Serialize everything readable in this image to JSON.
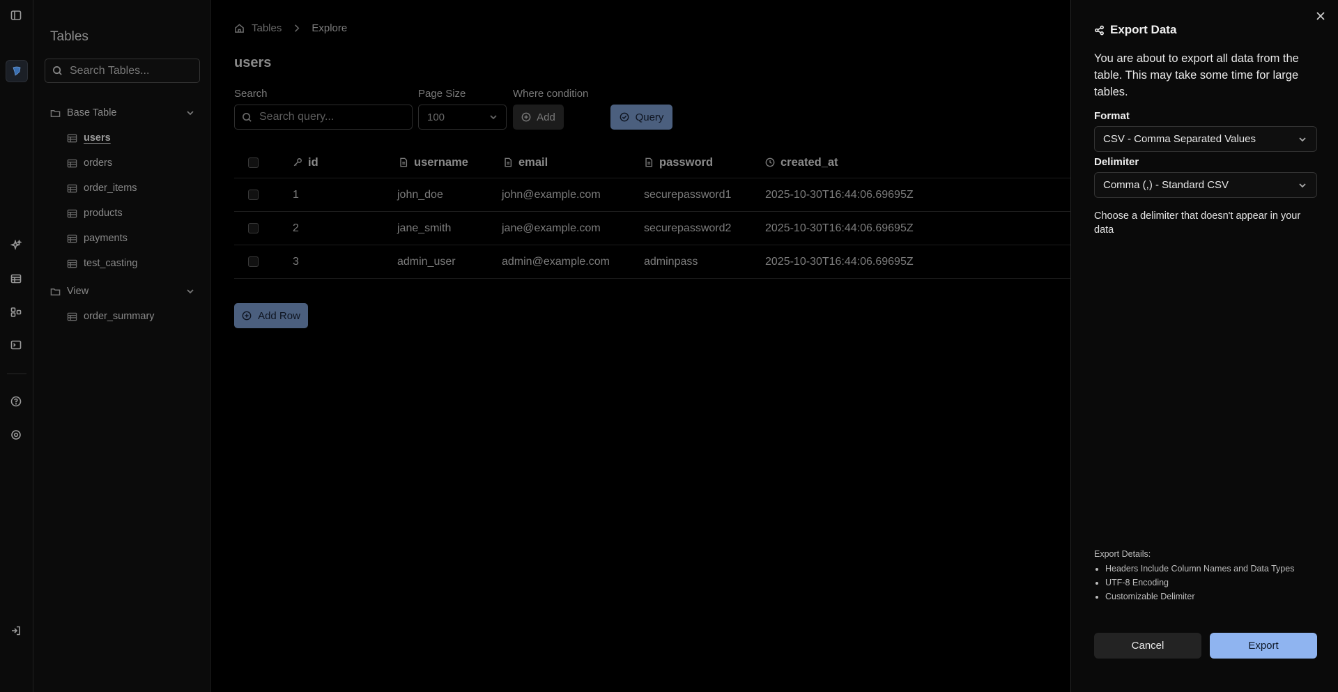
{
  "sidebar": {
    "title": "Tables",
    "search_placeholder": "Search Tables...",
    "groups": [
      {
        "label": "Base Table",
        "items": [
          "users",
          "orders",
          "order_items",
          "products",
          "payments",
          "test_casting"
        ]
      },
      {
        "label": "View",
        "items": [
          "order_summary"
        ]
      }
    ],
    "active_item": "users"
  },
  "breadcrumb": {
    "root": "Tables",
    "current": "Explore"
  },
  "page": {
    "title": "users",
    "search_label": "Search",
    "search_placeholder": "Search query...",
    "page_size_label": "Page Size",
    "page_size_value": "100",
    "where_label": "Where condition",
    "add_label": "Add",
    "query_label": "Query",
    "add_row_label": "Add Row"
  },
  "table": {
    "columns": [
      "id",
      "username",
      "email",
      "password",
      "created_at"
    ],
    "rows": [
      [
        "1",
        "john_doe",
        "john@example.com",
        "securepassword1",
        "2025-10-30T16:44:06.69695Z"
      ],
      [
        "2",
        "jane_smith",
        "jane@example.com",
        "securepassword2",
        "2025-10-30T16:44:06.69695Z"
      ],
      [
        "3",
        "admin_user",
        "admin@example.com",
        "adminpass",
        "2025-10-30T16:44:06.69695Z"
      ]
    ]
  },
  "export_panel": {
    "title": "Export Data",
    "description": "You are about to export all data from the table. This may take some time for large tables.",
    "format_label": "Format",
    "format_value": "CSV - Comma Separated Values",
    "delimiter_label": "Delimiter",
    "delimiter_value": "Comma (,) - Standard CSV",
    "hint": "Choose a delimiter that doesn't appear in your data",
    "details_title": "Export Details:",
    "details": [
      "Headers Include Column Names and Data Types",
      "UTF-8 Encoding",
      "Customizable Delimiter"
    ],
    "cancel_label": "Cancel",
    "export_label": "Export"
  },
  "colors": {
    "accent": "#8fb4f0",
    "muted_accent": "#4b5f7e",
    "background": "#000000"
  }
}
